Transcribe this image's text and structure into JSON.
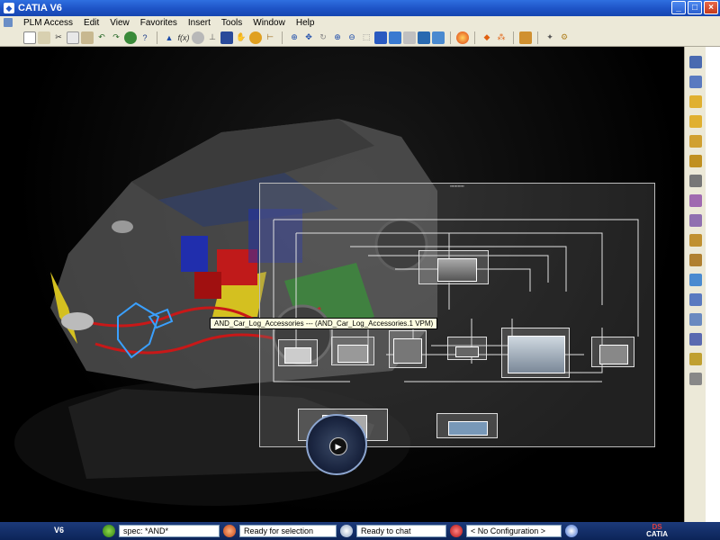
{
  "window": {
    "title": "CATIA V6",
    "minimize": "_",
    "maximize": "□",
    "close": "×"
  },
  "menu": [
    "PLM Access",
    "Edit",
    "View",
    "Favorites",
    "Insert",
    "Tools",
    "Window",
    "Help"
  ],
  "tooltip": "AND_Car_Log_Accessories --- (AND_Car_Log_Accessories.1 VPM)",
  "status": {
    "v6_label": "V6",
    "spec_field": "spec: *AND*",
    "selection_field": "Ready for selection",
    "chat_field": "Ready to chat",
    "config_field": "< No Configuration >",
    "logo_ds": "DS",
    "logo_catia": "CATIA"
  },
  "colors": {
    "titlebar": "#1f55c8",
    "chrome": "#ece9d8",
    "statusbar": "#0c2458",
    "highlight": "#3aa0ff"
  }
}
